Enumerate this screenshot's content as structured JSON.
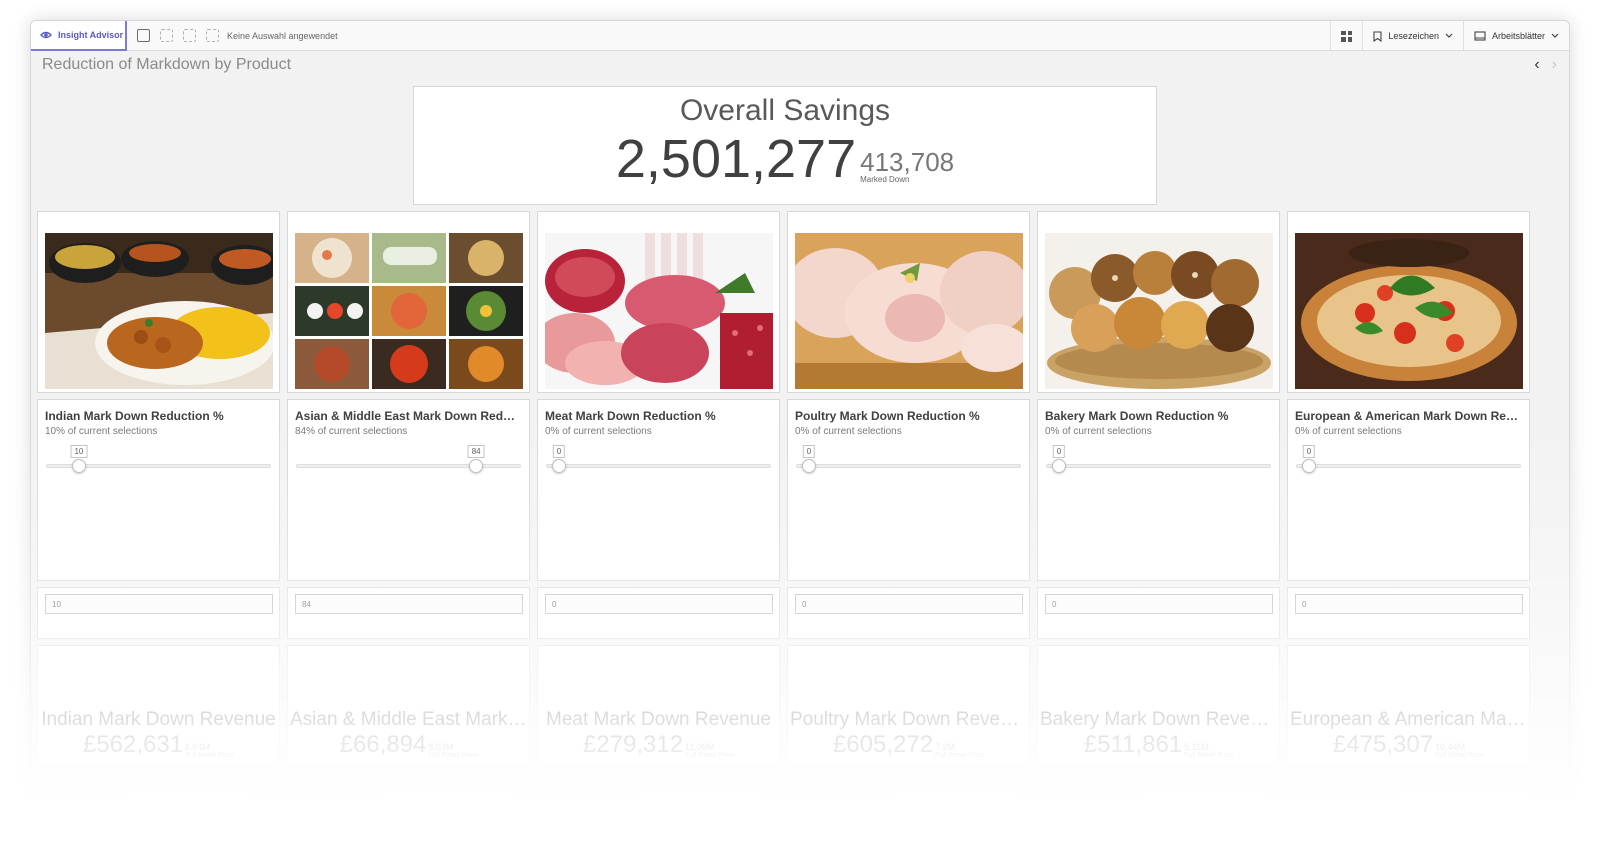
{
  "toolbar": {
    "insight_advisor_label": "Insight Advisor",
    "no_selection_text": "Keine Auswahl angewendet",
    "bookmarks_label": "Lesezeichen",
    "sheets_label": "Arbeitsblätter"
  },
  "sheet": {
    "title": "Reduction of Markdown by Product"
  },
  "kpi": {
    "title": "Overall Savings",
    "main_value": "2,501,277",
    "secondary_value": "413,708",
    "secondary_label": "Marked Down"
  },
  "products": [
    {
      "image": "indian-food-image",
      "slider_title": "Indian Mark Down Reduction %",
      "slider_subtitle": "10% of current selections",
      "slider_value": "10",
      "slider_fraction": 0.1,
      "input_value": "10",
      "revenue_title": "Indian Mark Down Revenue",
      "revenue_value": "£562,631",
      "revenue_secondary": "6.64M",
      "revenue_secondary_label": "Full Retail Price"
    },
    {
      "image": "asian-food-image",
      "slider_title": "Asian & Middle East Mark Down Reduction %",
      "slider_subtitle": "84% of current selections",
      "slider_value": "84",
      "slider_fraction": 0.84,
      "input_value": "84",
      "revenue_title": "Asian & Middle East Mark Down Revenue",
      "revenue_value": "£66,894",
      "revenue_secondary": "8.03M",
      "revenue_secondary_label": "Full Retail Price"
    },
    {
      "image": "meat-image",
      "slider_title": "Meat Mark Down Reduction %",
      "slider_subtitle": "0% of current selections",
      "slider_value": "0",
      "slider_fraction": 0,
      "input_value": "0",
      "revenue_title": "Meat Mark Down Revenue",
      "revenue_value": "£279,312",
      "revenue_secondary": "11.06M",
      "revenue_secondary_label": "Full Retail Price"
    },
    {
      "image": "poultry-image",
      "slider_title": "Poultry Mark Down Reduction %",
      "slider_subtitle": "0% of current selections",
      "slider_value": "0",
      "slider_fraction": 0,
      "input_value": "0",
      "revenue_title": "Poultry Mark Down Revenue",
      "revenue_value": "£605,272",
      "revenue_secondary": "7.2M",
      "revenue_secondary_label": "Full Retail Price"
    },
    {
      "image": "bakery-image",
      "slider_title": "Bakery Mark Down Reduction %",
      "slider_subtitle": "0% of current selections",
      "slider_value": "0",
      "slider_fraction": 0,
      "input_value": "0",
      "revenue_title": "Bakery Mark Down Revenue",
      "revenue_value": "£511,861",
      "revenue_secondary": "5.11M",
      "revenue_secondary_label": "Full Retail Price"
    },
    {
      "image": "pizza-image",
      "slider_title": "European & American Mark Down Reduction %",
      "slider_subtitle": "0% of current selections",
      "slider_value": "0",
      "slider_fraction": 0,
      "input_value": "0",
      "revenue_title": "European & American Mark Down Revenue",
      "revenue_value": "£475,307",
      "revenue_secondary": "10.44M",
      "revenue_secondary_label": "Full Retail Price"
    }
  ],
  "colors": {
    "accent": "#5a5ac8",
    "panel_background": "#f2f2f2",
    "card_background": "#ffffff"
  }
}
